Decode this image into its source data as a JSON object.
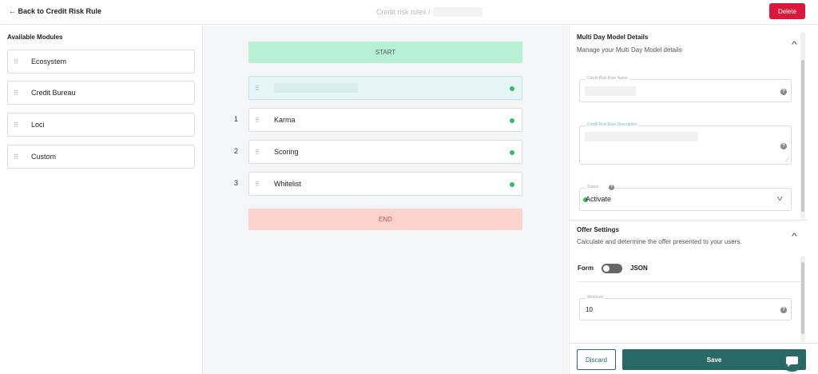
{
  "header": {
    "back_label": "← Back to Credit Risk Rule",
    "breadcrumb": "Credit risk rules /",
    "delete_label": "Delete"
  },
  "modules": {
    "title": "Available Modules",
    "items": [
      {
        "label": "Ecosystem"
      },
      {
        "label": "Credit Bureau"
      },
      {
        "label": "Loci"
      },
      {
        "label": "Custom"
      }
    ]
  },
  "flow": {
    "start_label": "START",
    "end_label": "END",
    "steps": [
      {
        "num": "1",
        "label": "Karma"
      },
      {
        "num": "2",
        "label": "Scoring"
      },
      {
        "num": "3",
        "label": "Whitelist"
      }
    ]
  },
  "details": {
    "title": "Multi Day Model Details",
    "description": "Manage your Multi Day Model details",
    "name_label": "Credit Risk Rule Name",
    "description_label": "Credit Risk Rule Description",
    "status_label": "Status",
    "status_value": "Activate",
    "help_glyph": "?"
  },
  "offer": {
    "title": "Offer Settings",
    "description": "Calculate and determine the offer presented to your users.",
    "form_label": "Form",
    "json_label": "JSON",
    "minimum_label": "Minimum",
    "minimum_value": "10"
  },
  "footer": {
    "discard_label": "Discard",
    "save_label": "Save"
  },
  "colors": {
    "accent": "#2a6a66",
    "delete": "#d9183b",
    "start": "#b8f0d6",
    "end": "#fcd2cd",
    "status_dot": "#2ec25b"
  }
}
